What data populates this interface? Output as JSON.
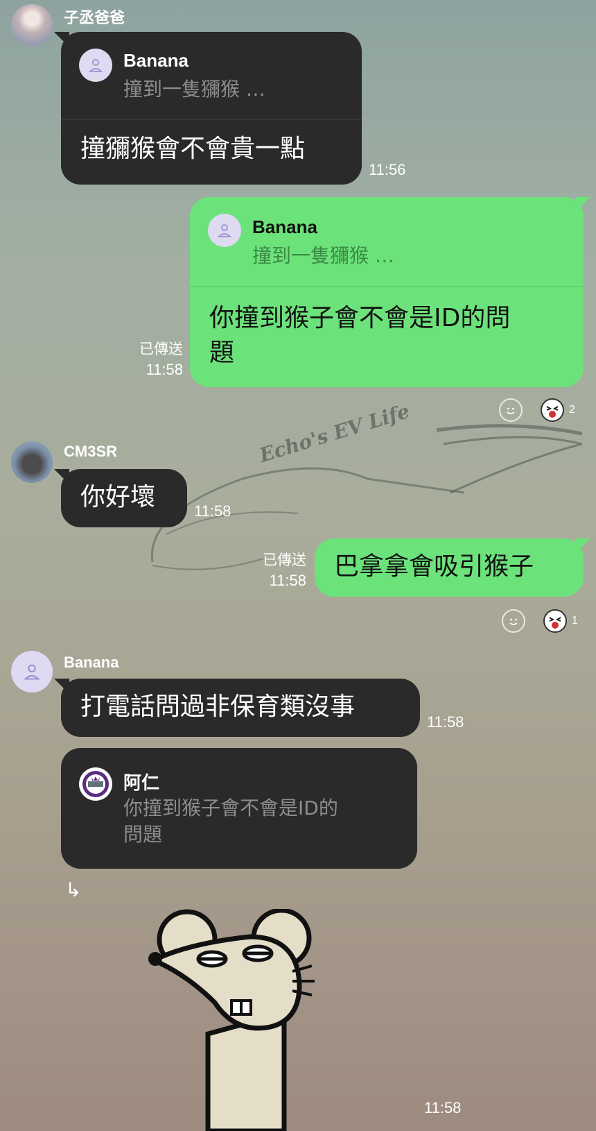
{
  "watermark": {
    "text": "Echo's EV Life"
  },
  "messages": {
    "m1": {
      "sender": "子丞爸爸",
      "reply_to": {
        "name": "Banana",
        "text": "撞到一隻獼猴 …"
      },
      "text": "撞獼猴會不會貴一點",
      "time": "11:56"
    },
    "m2": {
      "reply_to": {
        "name": "Banana",
        "text": "撞到一隻獼猴 …"
      },
      "text_line1": "你撞到猴子會不會是ID的問",
      "text_line2": "題",
      "status": "已傳送",
      "time": "11:58",
      "reaction_count": "2"
    },
    "m3": {
      "sender": "CM3SR",
      "text": "你好壞",
      "time": "11:58"
    },
    "m4": {
      "text": "巴拿拿會吸引猴子",
      "status": "已傳送",
      "time": "11:58",
      "reaction_count": "1"
    },
    "m5": {
      "sender": "Banana",
      "text": "打電話問過非保育類沒事",
      "time": "11:58"
    },
    "m6": {
      "reply_to": {
        "name": "阿仁",
        "text_line1": "你撞到猴子會不會是ID的",
        "text_line2": "問題"
      },
      "forward_icon": "↳"
    },
    "m7": {
      "sticker": "rat-sticker",
      "time": "11:58"
    }
  },
  "colors": {
    "green_bubble": "#6ce27b",
    "dark_bubble": "#2a2a2a"
  },
  "icons": [
    "person-icon",
    "smiley-icon",
    "sticker-reaction-icon",
    "kings-logo-icon",
    "forward-icon"
  ]
}
